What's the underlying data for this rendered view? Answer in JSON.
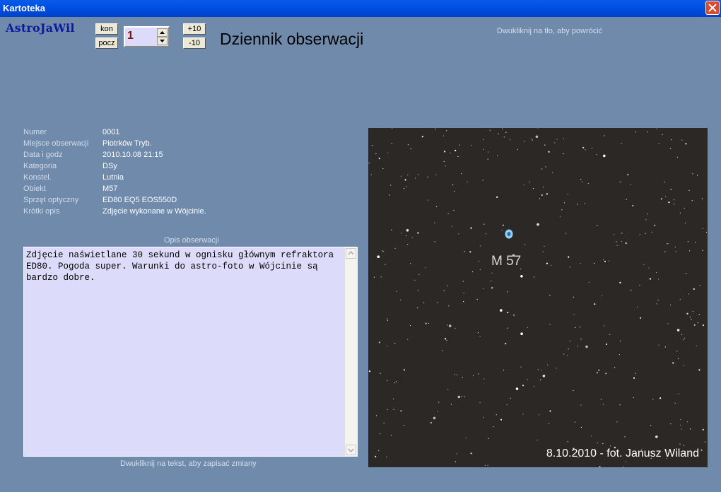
{
  "window": {
    "title": "Kartoteka"
  },
  "logo": "AstroJaWil",
  "nav": {
    "kon": "kon",
    "pocz": "pocz",
    "plus10": "+10",
    "minus10": "-10",
    "record": "1"
  },
  "heading": "Dziennik obserwacji",
  "hints": {
    "top": "Dwukliknij na tło, aby powrócić",
    "bottom": "Dwukliknij na tekst, aby zapisać zmiany"
  },
  "fields": [
    {
      "label": "Numer",
      "value": "0001"
    },
    {
      "label": "Miejsce obserwacji",
      "value": "Piotrków Tryb."
    },
    {
      "label": "Data i godz",
      "value": "2010.10.08 21:15"
    },
    {
      "label": "Kategoria",
      "value": "DSy"
    },
    {
      "label": "Konstel.",
      "value": "Lutnia"
    },
    {
      "label": "Obiekt",
      "value": "M57"
    },
    {
      "label": "Sprzęt optyczny",
      "value": "ED80 EQ5 EOS550D"
    },
    {
      "label": "Krótki opis",
      "value": "Zdjęcie wykonane w Wójcinie."
    }
  ],
  "description": {
    "label": "Opis obserwacji",
    "text": "Zdjęcie naświetlane 30 sekund w ognisku głównym refraktora ED80. Pogoda super. Warunki do astro-foto w Wójcinie są bardzo dobre."
  },
  "photo": {
    "object_label": "M 57",
    "caption": "8.10.2010 - fot. Janusz Wiland"
  },
  "colors": {
    "background": "#6f8aab",
    "titlebar": "#0050e6",
    "textarea": "#dcdcfa",
    "logo": "#0b1aa0"
  }
}
